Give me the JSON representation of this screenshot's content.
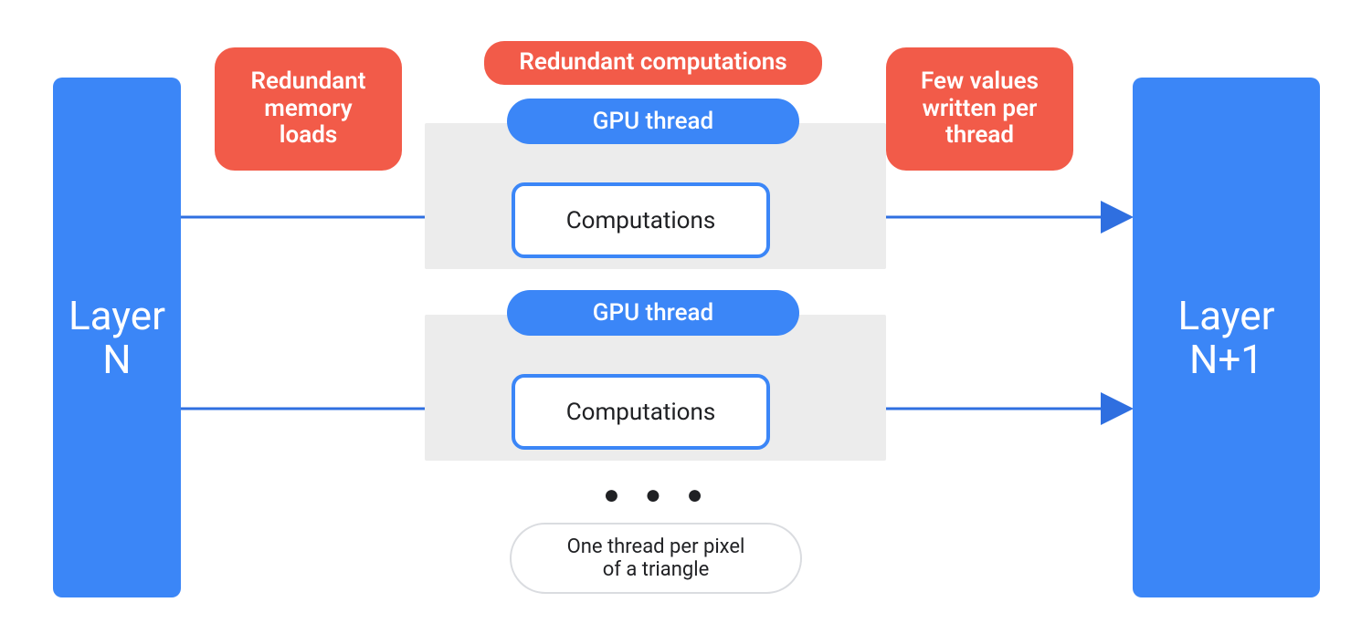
{
  "colors": {
    "blue": "#3b86f7",
    "red": "#f25b49",
    "grey": "#ececec",
    "white": "#ffffff",
    "text_dark": "#202124"
  },
  "left_layer": {
    "label": "Layer\nN"
  },
  "right_layer": {
    "label": "Layer\nN+1"
  },
  "callouts": {
    "memory_loads": "Redundant\nmemory\nloads",
    "redundant_comp": "Redundant computations",
    "few_values": "Few values\nwritten per\nthread"
  },
  "threads": [
    {
      "pill": "GPU thread",
      "box": "Computations"
    },
    {
      "pill": "GPU thread",
      "box": "Computations"
    }
  ],
  "ellipsis": "● ● ●",
  "footer": "One thread per pixel\nof a triangle"
}
